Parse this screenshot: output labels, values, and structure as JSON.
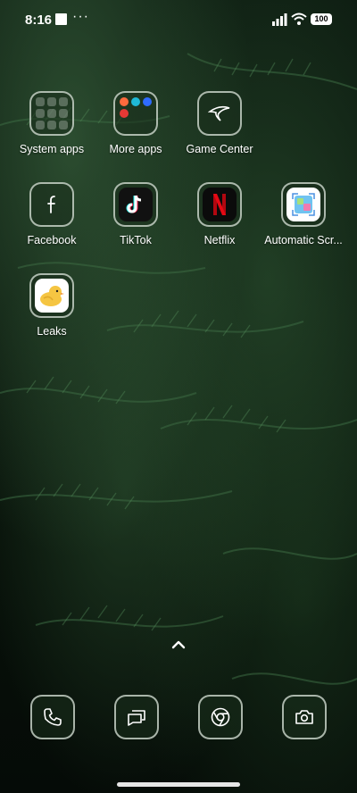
{
  "status_bar": {
    "time": "8:16",
    "dots": "···",
    "battery": "100"
  },
  "apps": [
    {
      "label": "System apps",
      "icon": "folder-icon"
    },
    {
      "label": "More apps",
      "icon": "folder-icon"
    },
    {
      "label": "Game Center",
      "icon": "game-center-icon"
    },
    {
      "label": "Facebook",
      "icon": "facebook-icon"
    },
    {
      "label": "TikTok",
      "icon": "tiktok-icon"
    },
    {
      "label": "Netflix",
      "icon": "netflix-icon"
    },
    {
      "label": "Automatic Scr...",
      "icon": "screenshot-app-icon"
    },
    {
      "label": "Leaks",
      "icon": "leaks-icon"
    }
  ],
  "dock": [
    {
      "icon": "phone-icon"
    },
    {
      "icon": "messages-icon"
    },
    {
      "icon": "chrome-icon"
    },
    {
      "icon": "camera-icon"
    }
  ],
  "colors": {
    "tiktok_red": "#fe2c55",
    "tiktok_cyan": "#25f4ee",
    "netflix_red": "#e50914",
    "leaks_yellow": "#f5c542"
  }
}
